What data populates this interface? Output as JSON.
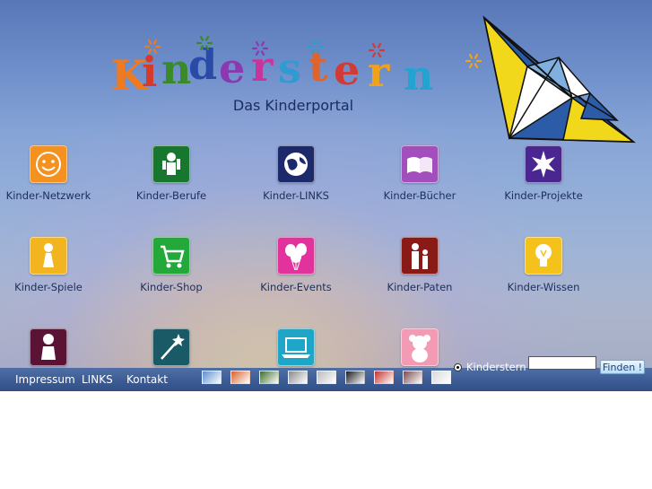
{
  "header": {
    "logo_text": "Kinderstern",
    "logo_letters": [
      "K",
      "i",
      "n",
      "d",
      "e",
      "r",
      "s",
      "t",
      "e",
      "r",
      "n"
    ],
    "logo_colors": [
      "#f07a1e",
      "#d63a2a",
      "#3b8a2a",
      "#2a4aa8",
      "#8a3ab0",
      "#c7349a",
      "#2f9bd0",
      "#e0632a",
      "#d23b33",
      "#f1a21c",
      "#23a3cf"
    ],
    "subtitle": "Das Kinderportal"
  },
  "grid": [
    {
      "label": "Kinder-Netzwerk",
      "icon": "smiley-icon",
      "color": "#f5911f"
    },
    {
      "label": "Kinder-Berufe",
      "icon": "worker-icon",
      "color": "#17772e"
    },
    {
      "label": "Kinder-LINKS",
      "icon": "globe-icon",
      "color": "#1c2a6b"
    },
    {
      "label": "Kinder-Bücher",
      "icon": "book-icon",
      "color": "#a24fbd"
    },
    {
      "label": "Kinder-Projekte",
      "icon": "star-icon",
      "color": "#4a2690"
    },
    {
      "label": "Kinder-Spiele",
      "icon": "game-piece-icon",
      "color": "#f3b51f"
    },
    {
      "label": "Kinder-Shop",
      "icon": "cart-icon",
      "color": "#22a93a"
    },
    {
      "label": "Kinder-Events",
      "icon": "balloons-icon",
      "color": "#e2339c"
    },
    {
      "label": "Kinder-Paten",
      "icon": "parent-child-icon",
      "color": "#8a1a16"
    },
    {
      "label": "Kinder-Wissen",
      "icon": "lightbulb-icon",
      "color": "#f4c21a"
    },
    {
      "label": "",
      "icon": "baby-icon",
      "color": "#5a1335"
    },
    {
      "label": "",
      "icon": "magic-wand-icon",
      "color": "#1a5a66"
    },
    {
      "label": "",
      "icon": "laptop-icon",
      "color": "#1ea6c9"
    },
    {
      "label": "",
      "icon": "teddy-bear-icon",
      "color": "#f39ab5"
    }
  ],
  "footer": {
    "links": [
      "Impressum",
      "LINKS",
      "Kontakt"
    ],
    "thumbnails": [
      {
        "icon": "flag-thumb-icon",
        "color": "#5b8fd0"
      },
      {
        "icon": "flowers-thumb-icon",
        "color": "#d9622a"
      },
      {
        "icon": "nature-thumb-icon",
        "color": "#3f6e2a"
      },
      {
        "icon": "people-thumb-icon",
        "color": "#8a8a8a"
      },
      {
        "icon": "grey-thumb-icon",
        "color": "#bcbcbc"
      },
      {
        "icon": "night-thumb-icon",
        "color": "#1a1a1a"
      },
      {
        "icon": "flower-red-thumb-icon",
        "color": "#c6302a"
      },
      {
        "icon": "city-thumb-icon",
        "color": "#7a4a4a"
      },
      {
        "icon": "animal-thumb-icon",
        "color": "#d9d9d9"
      }
    ]
  },
  "search": {
    "radio_label": "Kinderstern",
    "input_value": "",
    "button_label": "Finden !"
  }
}
